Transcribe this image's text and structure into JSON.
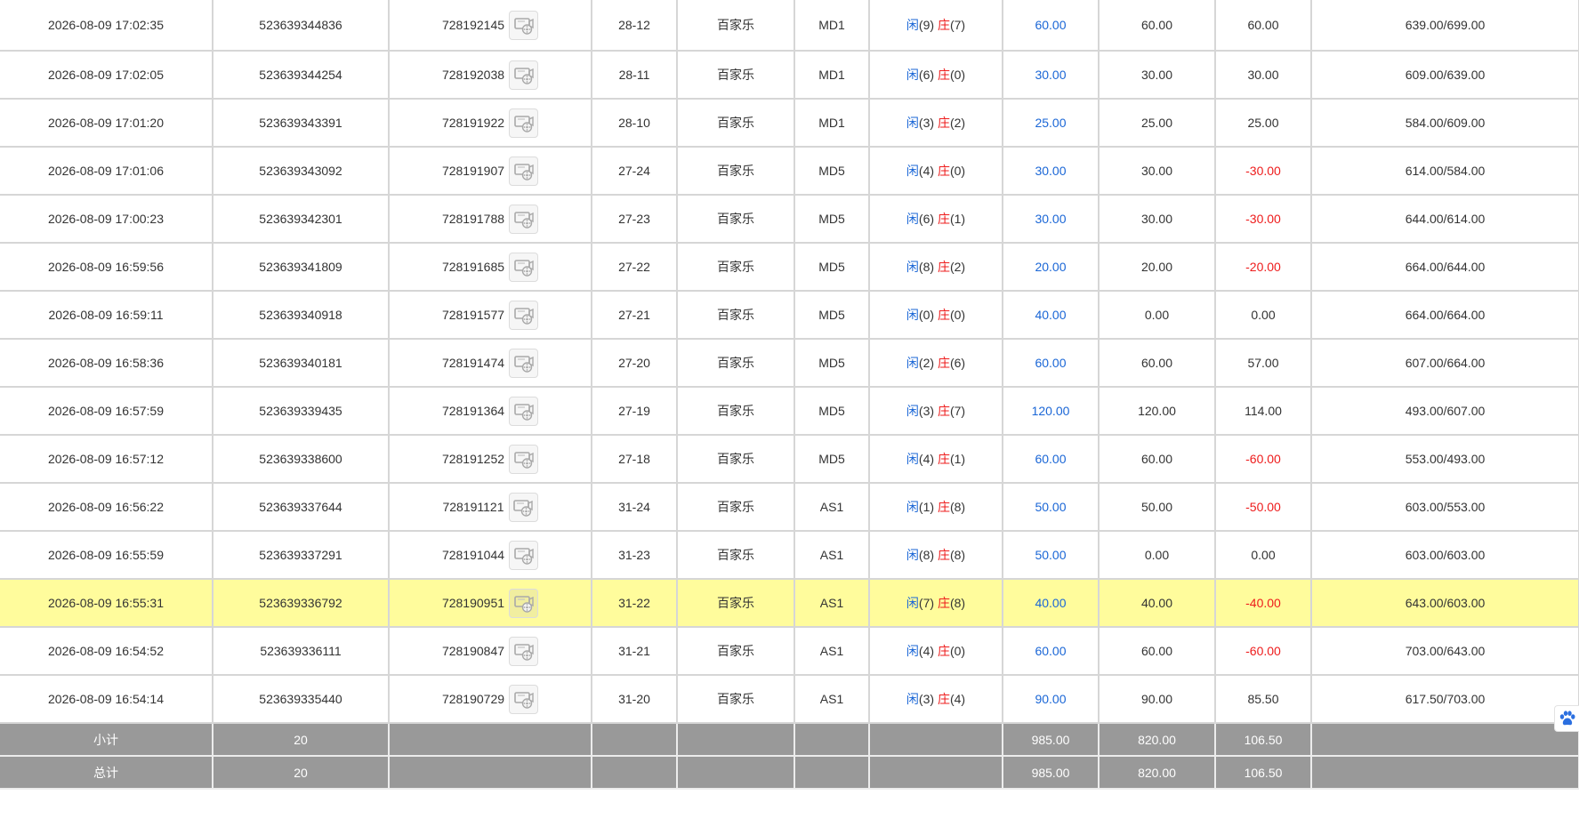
{
  "rows": [
    {
      "time": "2026-08-09 17:02:35",
      "order_no": "523639344836",
      "round_id": "728192145",
      "shoe": "28-12",
      "game": "百家乐",
      "table": "MD1",
      "p": "闲",
      "pv": "(9)",
      "b": "庄",
      "bv": "(7)",
      "bet": "60.00",
      "valid": "60.00",
      "win": "60.00",
      "win_type": "pos",
      "balance": "639.00/699.00"
    },
    {
      "time": "2026-08-09 17:02:05",
      "order_no": "523639344254",
      "round_id": "728192038",
      "shoe": "28-11",
      "game": "百家乐",
      "table": "MD1",
      "p": "闲",
      "pv": "(6)",
      "b": "庄",
      "bv": "(0)",
      "bet": "30.00",
      "valid": "30.00",
      "win": "30.00",
      "win_type": "pos",
      "balance": "609.00/639.00"
    },
    {
      "time": "2026-08-09 17:01:20",
      "order_no": "523639343391",
      "round_id": "728191922",
      "shoe": "28-10",
      "game": "百家乐",
      "table": "MD1",
      "p": "闲",
      "pv": "(3)",
      "b": "庄",
      "bv": "(2)",
      "bet": "25.00",
      "valid": "25.00",
      "win": "25.00",
      "win_type": "pos",
      "balance": "584.00/609.00"
    },
    {
      "time": "2026-08-09 17:01:06",
      "order_no": "523639343092",
      "round_id": "728191907",
      "shoe": "27-24",
      "game": "百家乐",
      "table": "MD5",
      "p": "闲",
      "pv": "(4)",
      "b": "庄",
      "bv": "(0)",
      "bet": "30.00",
      "valid": "30.00",
      "win": "-30.00",
      "win_type": "neg",
      "balance": "614.00/584.00"
    },
    {
      "time": "2026-08-09 17:00:23",
      "order_no": "523639342301",
      "round_id": "728191788",
      "shoe": "27-23",
      "game": "百家乐",
      "table": "MD5",
      "p": "闲",
      "pv": "(6)",
      "b": "庄",
      "bv": "(1)",
      "bet": "30.00",
      "valid": "30.00",
      "win": "-30.00",
      "win_type": "neg",
      "balance": "644.00/614.00"
    },
    {
      "time": "2026-08-09 16:59:56",
      "order_no": "523639341809",
      "round_id": "728191685",
      "shoe": "27-22",
      "game": "百家乐",
      "table": "MD5",
      "p": "闲",
      "pv": "(8)",
      "b": "庄",
      "bv": "(2)",
      "bet": "20.00",
      "valid": "20.00",
      "win": "-20.00",
      "win_type": "neg",
      "balance": "664.00/644.00"
    },
    {
      "time": "2026-08-09 16:59:11",
      "order_no": "523639340918",
      "round_id": "728191577",
      "shoe": "27-21",
      "game": "百家乐",
      "table": "MD5",
      "p": "闲",
      "pv": "(0)",
      "b": "庄",
      "bv": "(0)",
      "bet": "40.00",
      "valid": "0.00",
      "win": "0.00",
      "win_type": "pos",
      "balance": "664.00/664.00"
    },
    {
      "time": "2026-08-09 16:58:36",
      "order_no": "523639340181",
      "round_id": "728191474",
      "shoe": "27-20",
      "game": "百家乐",
      "table": "MD5",
      "p": "闲",
      "pv": "(2)",
      "b": "庄",
      "bv": "(6)",
      "bet": "60.00",
      "valid": "60.00",
      "win": "57.00",
      "win_type": "pos",
      "balance": "607.00/664.00"
    },
    {
      "time": "2026-08-09 16:57:59",
      "order_no": "523639339435",
      "round_id": "728191364",
      "shoe": "27-19",
      "game": "百家乐",
      "table": "MD5",
      "p": "闲",
      "pv": "(3)",
      "b": "庄",
      "bv": "(7)",
      "bet": "120.00",
      "valid": "120.00",
      "win": "114.00",
      "win_type": "pos",
      "balance": "493.00/607.00"
    },
    {
      "time": "2026-08-09 16:57:12",
      "order_no": "523639338600",
      "round_id": "728191252",
      "shoe": "27-18",
      "game": "百家乐",
      "table": "MD5",
      "p": "闲",
      "pv": "(4)",
      "b": "庄",
      "bv": "(1)",
      "bet": "60.00",
      "valid": "60.00",
      "win": "-60.00",
      "win_type": "neg",
      "balance": "553.00/493.00"
    },
    {
      "time": "2026-08-09 16:56:22",
      "order_no": "523639337644",
      "round_id": "728191121",
      "shoe": "31-24",
      "game": "百家乐",
      "table": "AS1",
      "p": "闲",
      "pv": "(1)",
      "b": "庄",
      "bv": "(8)",
      "bet": "50.00",
      "valid": "50.00",
      "win": "-50.00",
      "win_type": "neg",
      "balance": "603.00/553.00"
    },
    {
      "time": "2026-08-09 16:55:59",
      "order_no": "523639337291",
      "round_id": "728191044",
      "shoe": "31-23",
      "game": "百家乐",
      "table": "AS1",
      "p": "闲",
      "pv": "(8)",
      "b": "庄",
      "bv": "(8)",
      "bet": "50.00",
      "valid": "0.00",
      "win": "0.00",
      "win_type": "pos",
      "balance": "603.00/603.00"
    },
    {
      "time": "2026-08-09 16:55:31",
      "order_no": "523639336792",
      "round_id": "728190951",
      "shoe": "31-22",
      "game": "百家乐",
      "table": "AS1",
      "p": "闲",
      "pv": "(7)",
      "b": "庄",
      "bv": "(8)",
      "bet": "40.00",
      "valid": "40.00",
      "win": "-40.00",
      "win_type": "neg",
      "balance": "643.00/603.00"
    },
    {
      "time": "2026-08-09 16:54:52",
      "order_no": "523639336111",
      "round_id": "728190847",
      "shoe": "31-21",
      "game": "百家乐",
      "table": "AS1",
      "p": "闲",
      "pv": "(4)",
      "b": "庄",
      "bv": "(0)",
      "bet": "60.00",
      "valid": "60.00",
      "win": "-60.00",
      "win_type": "neg",
      "balance": "703.00/643.00"
    },
    {
      "time": "2026-08-09 16:54:14",
      "order_no": "523639335440",
      "round_id": "728190729",
      "shoe": "31-20",
      "game": "百家乐",
      "table": "AS1",
      "p": "闲",
      "pv": "(3)",
      "b": "庄",
      "bv": "(4)",
      "bet": "90.00",
      "valid": "90.00",
      "win": "85.50",
      "win_type": "pos",
      "balance": "617.50/703.00"
    }
  ],
  "highlighted_row": 12,
  "video_icon": "video-replay-icon",
  "paw_icon": "paw-icon",
  "colors": {
    "blue": "#1a66d6",
    "red": "#ee1c1c",
    "highlight": "#fffc9c",
    "summary_bg": "#999999"
  },
  "subtotal": {
    "label": "小计",
    "count": "20",
    "bet": "985.00",
    "valid": "820.00",
    "win": "106.50"
  },
  "total": {
    "label": "总计",
    "count": "20",
    "bet": "985.00",
    "valid": "820.00",
    "win": "106.50"
  }
}
